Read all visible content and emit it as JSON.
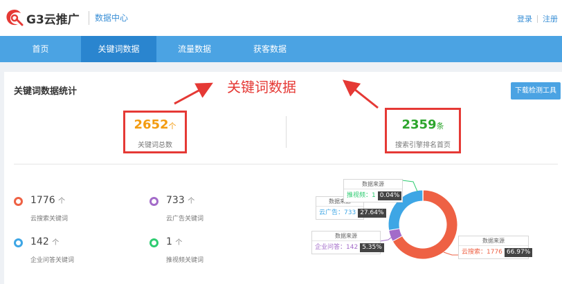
{
  "header": {
    "logo_text": "G3云推广",
    "subtitle": "数据中心",
    "login": "登录",
    "register": "注册"
  },
  "nav": {
    "items": [
      {
        "label": "首页",
        "active": false
      },
      {
        "label": "关键词数据",
        "active": true
      },
      {
        "label": "流量数据",
        "active": false
      },
      {
        "label": "获客数据",
        "active": false
      }
    ]
  },
  "panel": {
    "title": "关键词数据统计",
    "download_button": "下载检测工具",
    "annotation": "关键词数据"
  },
  "stats": [
    {
      "value": "2652",
      "unit": "个",
      "label": "关键词总数",
      "color": "#f39c12"
    },
    {
      "value": "2359",
      "unit": "条",
      "label": "搜索引擎排名首页",
      "color": "#2ca52c"
    }
  ],
  "legend": [
    {
      "value": "1776",
      "unit": "个",
      "label": "云搜索关键词",
      "color": "#ee6144"
    },
    {
      "value": "733",
      "unit": "个",
      "label": "云广告关键词",
      "color": "#a36bc9"
    },
    {
      "value": "142",
      "unit": "个",
      "label": "企业问答关键词",
      "color": "#3ea6e5"
    },
    {
      "value": "1",
      "unit": "个",
      "label": "推视频关键词",
      "color": "#2ecc71"
    }
  ],
  "chart_data": {
    "type": "pie",
    "donut": true,
    "slices": [
      {
        "name": "云搜索",
        "value": 1776,
        "percent": "66.97%",
        "color": "#ee6144"
      },
      {
        "name": "企业问答",
        "value": 142,
        "percent": "5.35%",
        "color": "#a36bc9"
      },
      {
        "name": "云广告",
        "value": 733,
        "percent": "27.64%",
        "color": "#3ea6e5"
      },
      {
        "name": "推视频",
        "value": 1,
        "percent": "0.04%",
        "color": "#2ecc71"
      }
    ],
    "tooltip_title": "数据来源",
    "tooltips": [
      {
        "text": "推视频：1",
        "percent": "0.04%",
        "color": "#2ecc71"
      },
      {
        "text": "云广告：733",
        "percent": "27.64%",
        "color": "#3ea6e5"
      },
      {
        "text": "企业问答：142",
        "percent": "5.35%",
        "color": "#a36bc9"
      },
      {
        "text": "云搜索：1776",
        "percent": "66.97%",
        "color": "#ee6144"
      }
    ]
  }
}
